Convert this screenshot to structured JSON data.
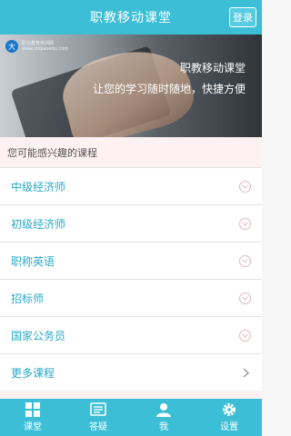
{
  "header": {
    "title": "职教移动课堂",
    "login_label": "登录"
  },
  "banner": {
    "logo_mark": "大",
    "logo_text_1": "职业教育培训网",
    "logo_text_2": "www.zhijiaoedu.com",
    "line1": "职教移动课堂",
    "line2": "让您的学习随时随地，快捷方便"
  },
  "section": {
    "title": "您可能感兴趣的课程"
  },
  "courses": [
    {
      "label": "中级经济师"
    },
    {
      "label": "初级经济师"
    },
    {
      "label": "职称英语"
    },
    {
      "label": "招标师"
    },
    {
      "label": "国家公务员"
    },
    {
      "label": "更多课程"
    }
  ],
  "tabs": [
    {
      "label": "课堂",
      "icon": "grid-icon"
    },
    {
      "label": "答疑",
      "icon": "chat-icon"
    },
    {
      "label": "我",
      "icon": "user-icon"
    },
    {
      "label": "设置",
      "icon": "gear-icon"
    }
  ],
  "colors": {
    "accent": "#3cbfd6",
    "link": "#2aa9c6",
    "section_bg": "#fdf1f2"
  }
}
